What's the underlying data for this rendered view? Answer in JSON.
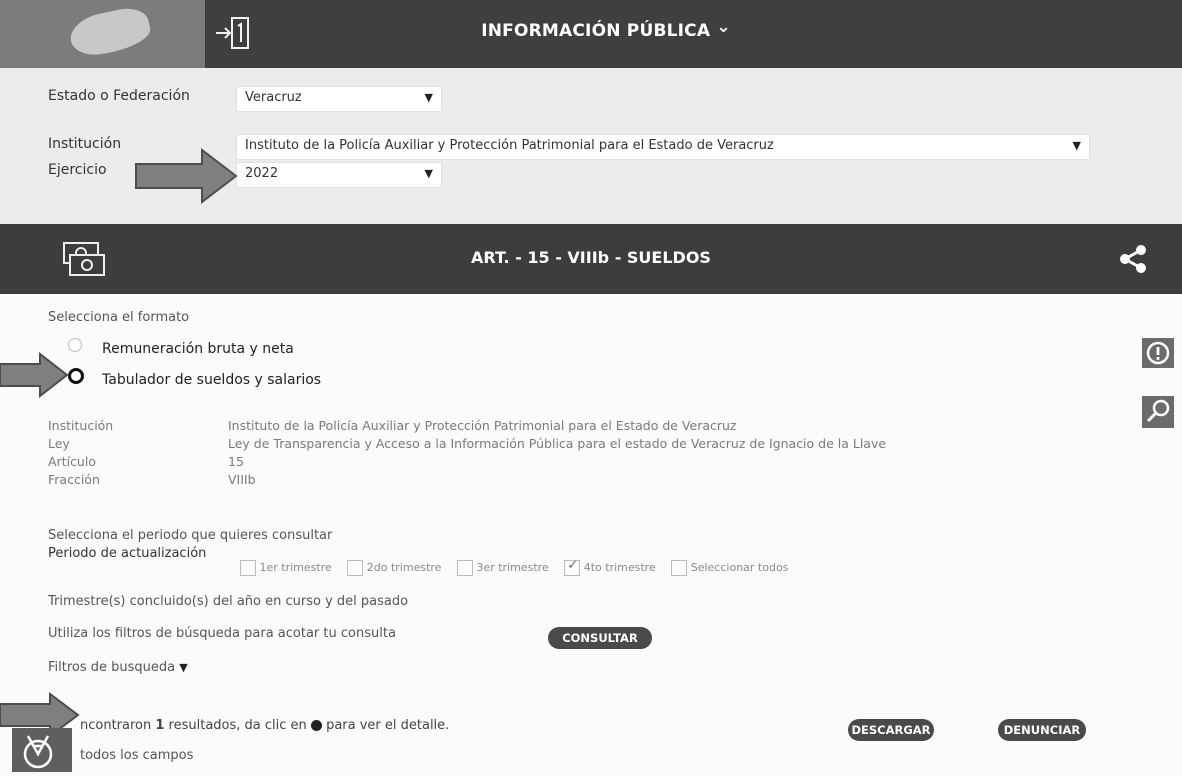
{
  "header": {
    "title": "INFORMACIÓN PÚBLICA",
    "title_chevron": "⌄"
  },
  "filters": {
    "estado_label": "Estado o Federación",
    "estado_value": "Veracruz",
    "institucion_label": "Institución",
    "institucion_value": "Instituto de la Policía Auxiliar y Protección Patrimonial para el Estado de Veracruz",
    "ejercicio_label": "Ejercicio",
    "ejercicio_value": "2022"
  },
  "section": {
    "title": "ART. - 15 - VIIIb - SUELDOS"
  },
  "format": {
    "label": "Selecciona el formato",
    "options": [
      "Remuneración bruta y neta",
      "Tabulador de sueldos y salarios"
    ],
    "selected_index": 1
  },
  "details": [
    {
      "label": "Institución",
      "value": "Instituto de la Policía Auxiliar y Protección Patrimonial para el Estado de Veracruz"
    },
    {
      "label": "Ley",
      "value": "Ley de Transparencia y Acceso a la Información Pública para el estado de Veracruz de Ignacio de la Llave"
    },
    {
      "label": "Artículo",
      "value": "15"
    },
    {
      "label": "Fracción",
      "value": "VIIIb"
    }
  ],
  "period": {
    "prompt": "Selecciona el periodo que quieres consultar",
    "label": "Periodo de actualización",
    "options": [
      "1er trimestre",
      "2do trimestre",
      "3er trimestre",
      "4to trimestre",
      "Seleccionar todos"
    ],
    "checked_index": 3,
    "note": "Trimestre(s) concluido(s) del año en curso y del pasado"
  },
  "filters_hint": "Utiliza los filtros de búsqueda para acotar tu consulta",
  "consultar_label": "CONSULTAR",
  "search_filters_label": "Filtros de busqueda",
  "results": {
    "text_before": "ncontraron ",
    "count": "1",
    "text_after": " resultados, da clic en",
    "text_end": "para ver el detalle.",
    "fields_text": "todos los campos"
  },
  "descargar_label": "DESCARGAR",
  "denunciar_label": "DENUNCIAR"
}
